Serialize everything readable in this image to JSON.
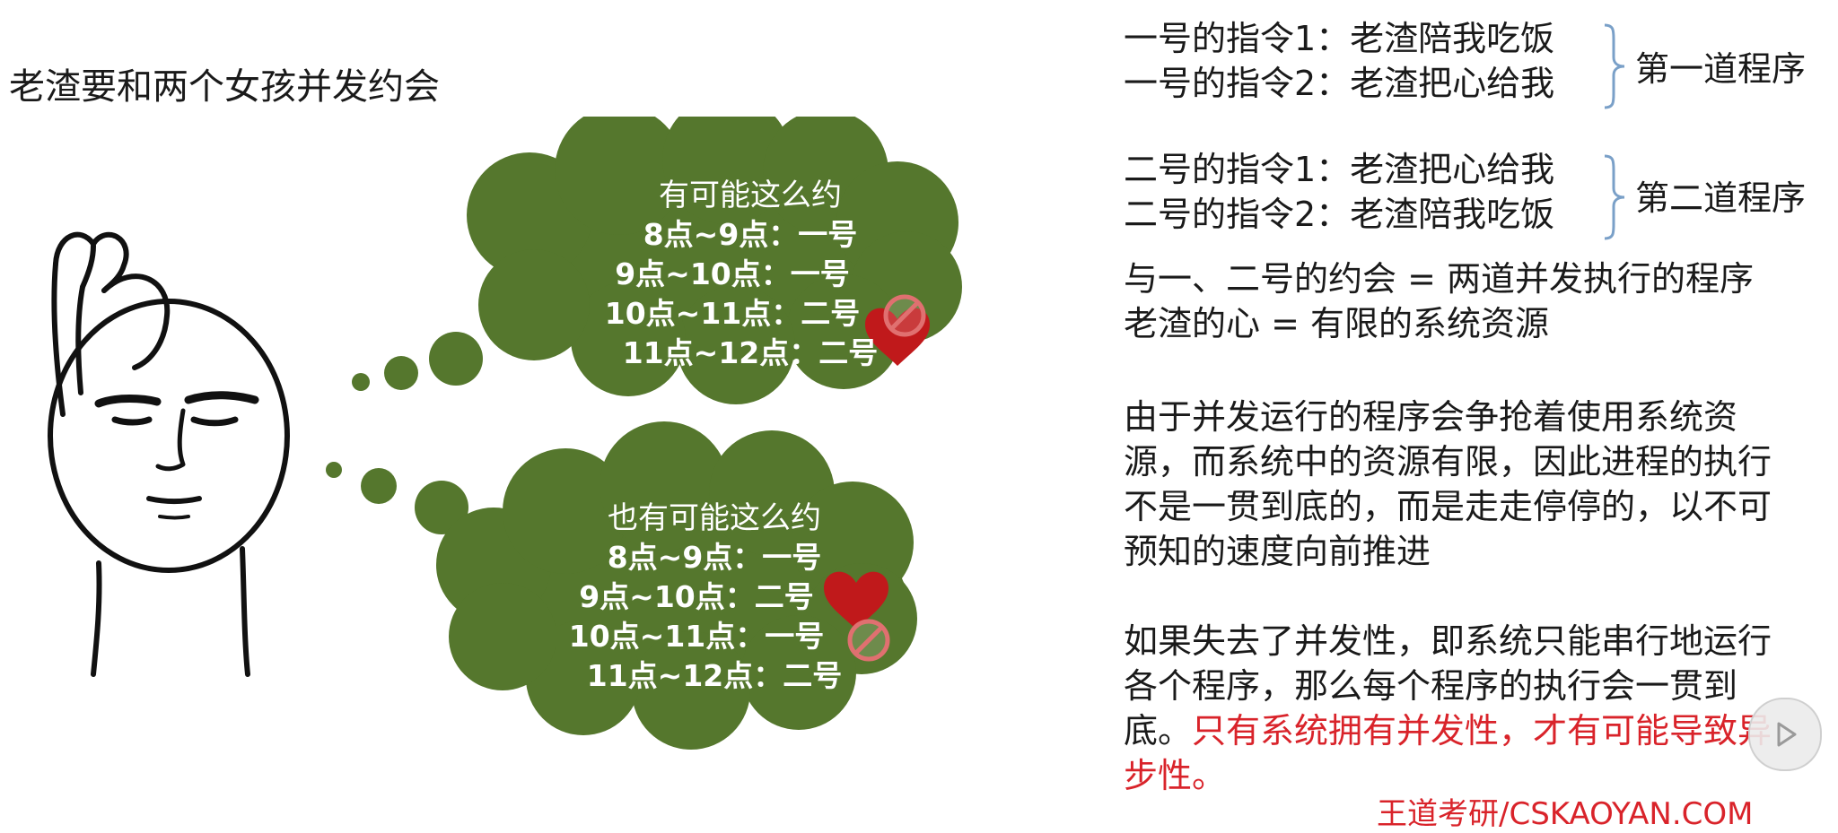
{
  "title": "老渣要和两个女孩并发约会",
  "cloud1": {
    "heading": "有可能这么约",
    "rows": [
      "8点~9点：一号",
      "9点~10点：一号",
      "10点~11点：二号",
      "11点~12点：二号"
    ]
  },
  "cloud2": {
    "heading": "也有可能这么约",
    "rows": [
      "8点~9点：一号",
      "9点~10点：二号",
      "10点~11点：一号",
      "11点~12点：二号"
    ]
  },
  "program1": {
    "lines": [
      "一号的指令1：老渣陪我吃饭",
      "一号的指令2：老渣把心给我"
    ],
    "label": "第一道程序"
  },
  "program2": {
    "lines": [
      "二号的指令1：老渣把心给我",
      "二号的指令2：老渣陪我吃饭"
    ],
    "label": "第二道程序"
  },
  "equivalences": [
    "与一、二号的约会 = 两道并发执行的程序",
    "老渣的心 = 有限的系统资源"
  ],
  "paragraph1": "由于并发运行的程序会争抢着使用系统资源，而系统中的资源有限，因此进程的执行不是一贯到底的，而是走走停停的，以不可预知的速度向前推进",
  "paragraph2": {
    "plain": "如果失去了并发性，即系统只能串行地运行各个程序，那么每个程序的执行会一贯到底。",
    "highlight": "只有系统拥有并发性，才有可能导致异步性。"
  },
  "footer": "王道考研/CSKAOYAN.COM",
  "colors": {
    "cloud": "#55772d",
    "heart": "#c0191b",
    "no_sign": "#e07070",
    "highlight": "#d9232a"
  }
}
